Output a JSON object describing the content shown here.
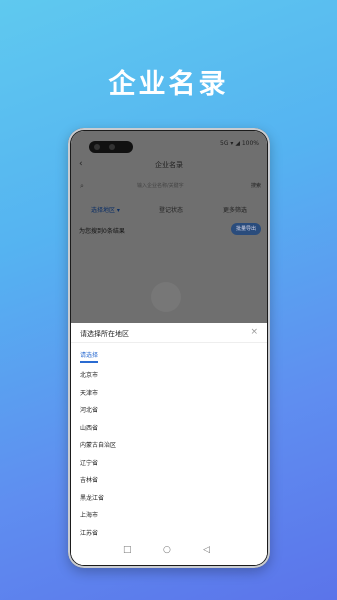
{
  "promo": {
    "title": "企业名录"
  },
  "status": {
    "text": "5G ▾ ◢ 100%"
  },
  "app": {
    "title": "企业名录"
  },
  "search": {
    "placeholder": "输入企业名称/关键字",
    "button": "搜索"
  },
  "filters": [
    "选择地区 ▾",
    "登记状态",
    "更多筛选"
  ],
  "summary": {
    "text": "为您搜到0条结果",
    "button": "批量导出"
  },
  "sheet": {
    "title": "请选择所在地区",
    "tab": "请选择",
    "regions": [
      "北京市",
      "天津市",
      "河北省",
      "山西省",
      "内蒙古自治区",
      "辽宁省",
      "吉林省",
      "黑龙江省",
      "上海市",
      "江苏省"
    ]
  },
  "navbar": {
    "square": "□",
    "circle": "○",
    "back": "◁"
  }
}
